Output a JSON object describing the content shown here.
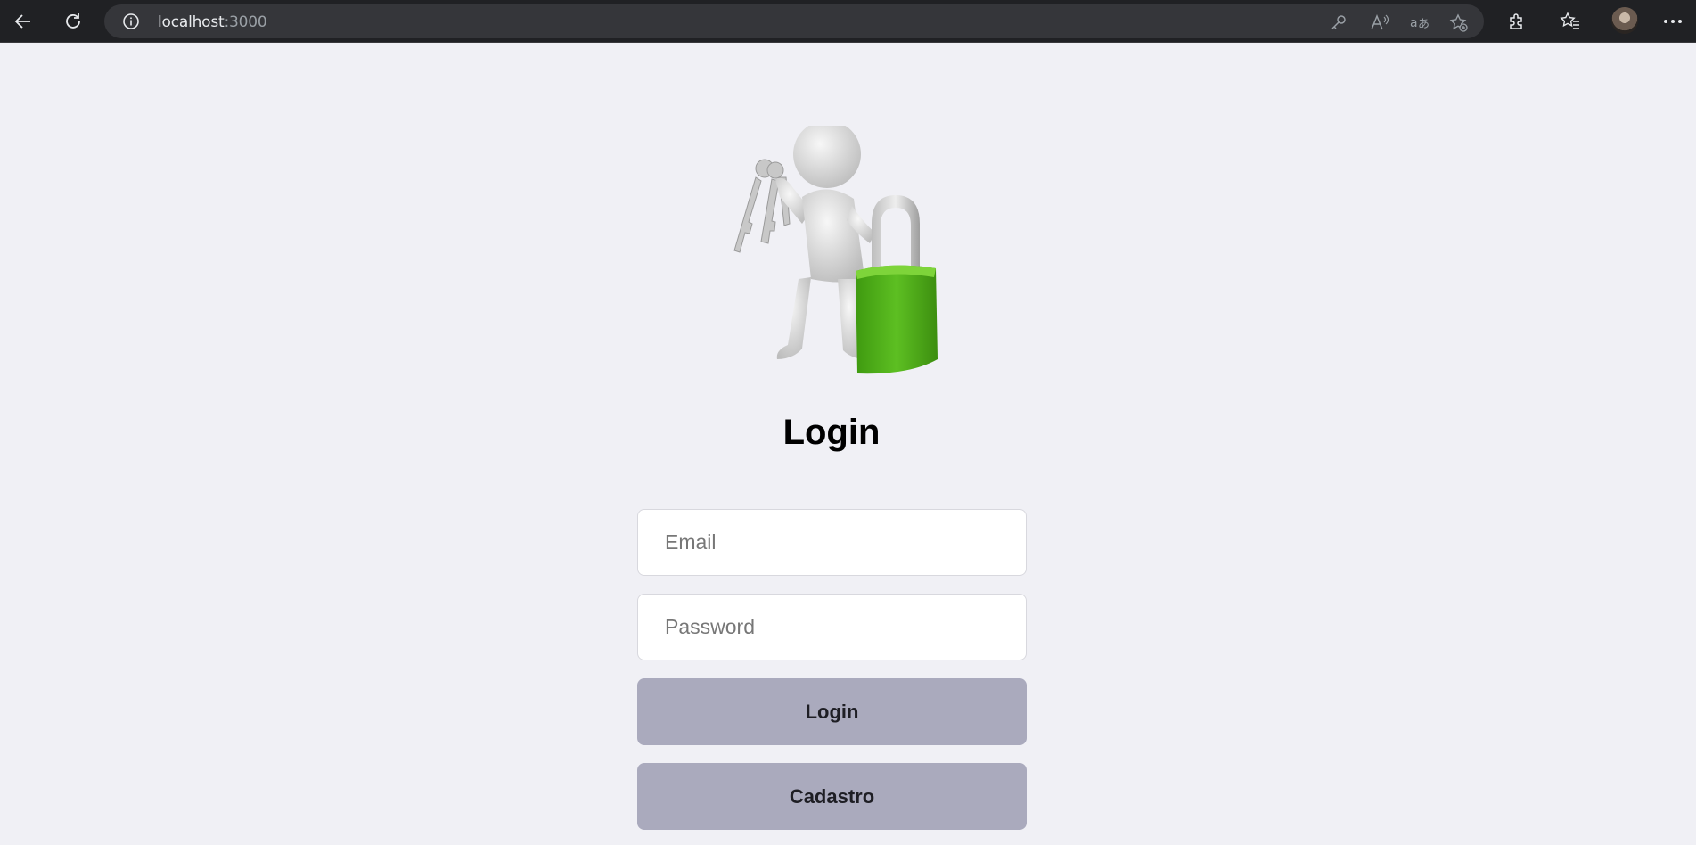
{
  "browser": {
    "url_host": "localhost",
    "url_port": ":3000",
    "icons": [
      "back-icon",
      "reload-icon",
      "info-icon",
      "key-icon",
      "read-aloud-icon",
      "translate-icon",
      "add-favorite-icon",
      "extensions-icon",
      "favorites-icon",
      "profile-avatar",
      "more-icon"
    ]
  },
  "login": {
    "title": "Login",
    "email_placeholder": "Email",
    "password_placeholder": "Password",
    "login_button": "Login",
    "register_button": "Cadastro"
  },
  "colors": {
    "page_bg": "#f0f0f5",
    "button_bg": "#aaaabd",
    "padlock_green": "#4fae1a"
  }
}
